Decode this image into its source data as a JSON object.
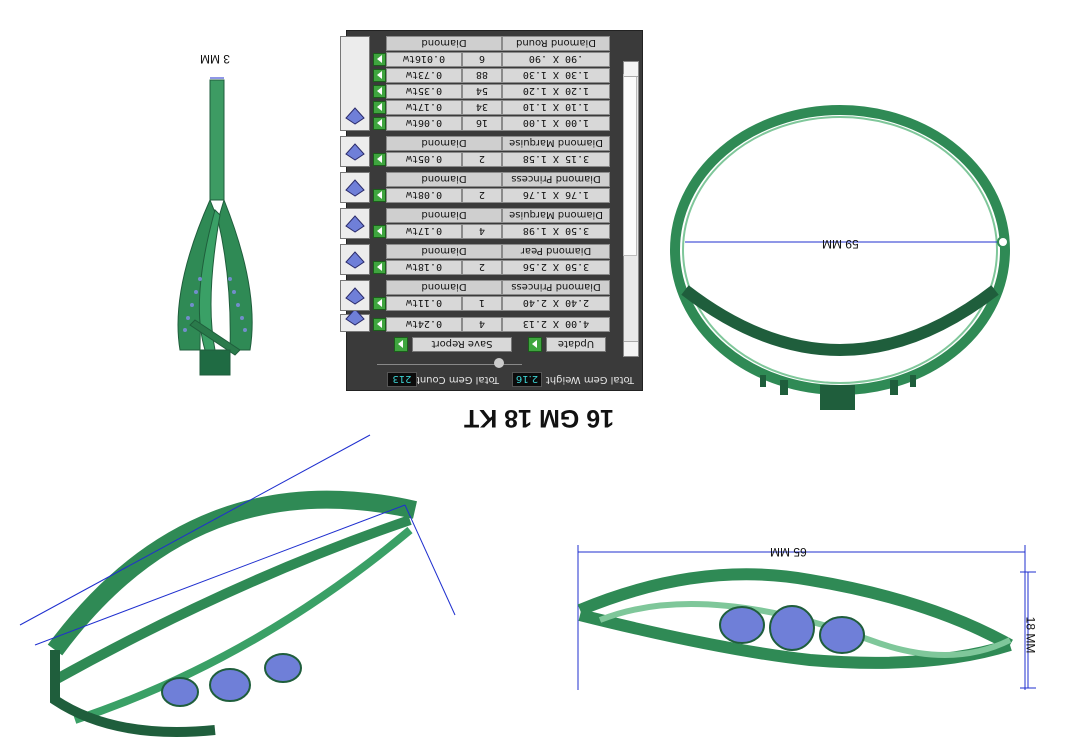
{
  "heading": "16 GM 18 KT",
  "dimensions": {
    "side_width": "3 MM",
    "inner_diameter": "59 MM",
    "outer_width": "65 MM",
    "height": "18 MM"
  },
  "report": {
    "total_gem_weight_label": "Total Gem Weight",
    "total_gem_weight_value": "2.16",
    "total_gem_count_label": "Total Gem Count",
    "total_gem_count_value": "213",
    "update_label": "Update",
    "save_report_label": "Save Report",
    "gems": [
      {
        "name": "",
        "shape": "",
        "rows": [
          {
            "size": "4.00 X 2.13",
            "count": "4",
            "weight": "0.24tw"
          }
        ]
      },
      {
        "name": "Diamond Princess",
        "shape": "Diamond",
        "rows": [
          {
            "size": "2.40 X 2.40",
            "count": "1",
            "weight": "0.11tw"
          }
        ]
      },
      {
        "name": "Diamond Pear",
        "shape": "Diamond",
        "rows": [
          {
            "size": "3.50 X 2.56",
            "count": "2",
            "weight": "0.18tw"
          }
        ]
      },
      {
        "name": "Diamond Marquise",
        "shape": "Diamond",
        "rows": [
          {
            "size": "3.50 X 1.98",
            "count": "4",
            "weight": "0.17tw"
          }
        ]
      },
      {
        "name": "Diamond Princess",
        "shape": "Diamond",
        "rows": [
          {
            "size": "1.76 X 1.76",
            "count": "2",
            "weight": "0.08tw"
          }
        ]
      },
      {
        "name": "Diamond Marquise",
        "shape": "Diamond",
        "rows": [
          {
            "size": "3.15 X 1.58",
            "count": "2",
            "weight": "0.05tw"
          }
        ]
      },
      {
        "name": "Diamond Round",
        "shape": "Diamond",
        "rows": [
          {
            "size": "1.00 X 1.00",
            "count": "16",
            "weight": "0.06tw"
          },
          {
            "size": "1.10 X 1.10",
            "count": "34",
            "weight": "0.17tw"
          },
          {
            "size": "1.20 X 1.20",
            "count": "54",
            "weight": "0.35tw"
          },
          {
            "size": "1.30 X 1.30",
            "count": "88",
            "weight": "0.73tw"
          },
          {
            "size": ".90 X .90",
            "count": "6",
            "weight": "0.016tw"
          }
        ]
      }
    ]
  },
  "colors": {
    "metal": "#2e8b57",
    "gem": "#6f7fd8",
    "dimension_line": "#1f2fcf",
    "panel": "#3a3a3a"
  },
  "icons": [
    "diamond-round-icon",
    "diamond-princess-icon",
    "diamond-pear-icon",
    "diamond-marquise-icon",
    "arrow-right-icon",
    "scroll-up-icon",
    "scroll-down-icon"
  ]
}
